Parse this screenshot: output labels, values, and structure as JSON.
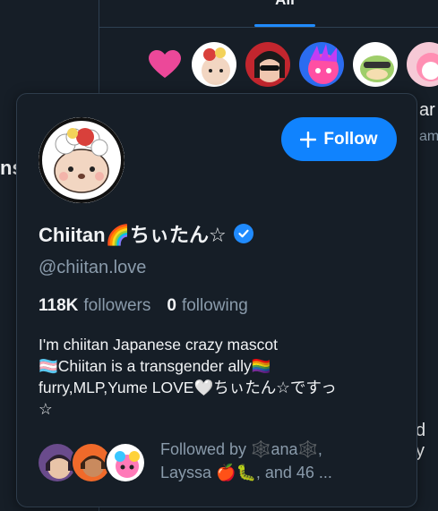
{
  "tabs": {
    "active_label": "All"
  },
  "side": {
    "left_fragment": "ns",
    "right_fragment_1": "ar",
    "right_fragment_2": "am",
    "right_fragment_3": "d y"
  },
  "card": {
    "display_name": "Chiitan🌈ちぃたん☆",
    "handle": "@chiitan.love",
    "follow_label": "Follow",
    "followers_count": "118K",
    "followers_label": "followers",
    "following_count": "0",
    "following_label": "following",
    "bio_line1": "I'm chiitan Japanese crazy mascot",
    "bio_line2": "🏳️‍⚧️Chiitan is a transgender ally🏳️‍🌈",
    "bio_line3": "furry,MLP,Yume LOVE🤍ちぃたん☆ですっ",
    "bio_line4": "☆",
    "followed_by_line1": "Followed by 🕸️ana🕸️,",
    "followed_by_line2": "Layssa 🍎🐛, and 46 ..."
  },
  "colors": {
    "accent": "#1083fe",
    "background": "#161e27",
    "muted": "#8a9bab",
    "border": "#2e3c4b"
  }
}
